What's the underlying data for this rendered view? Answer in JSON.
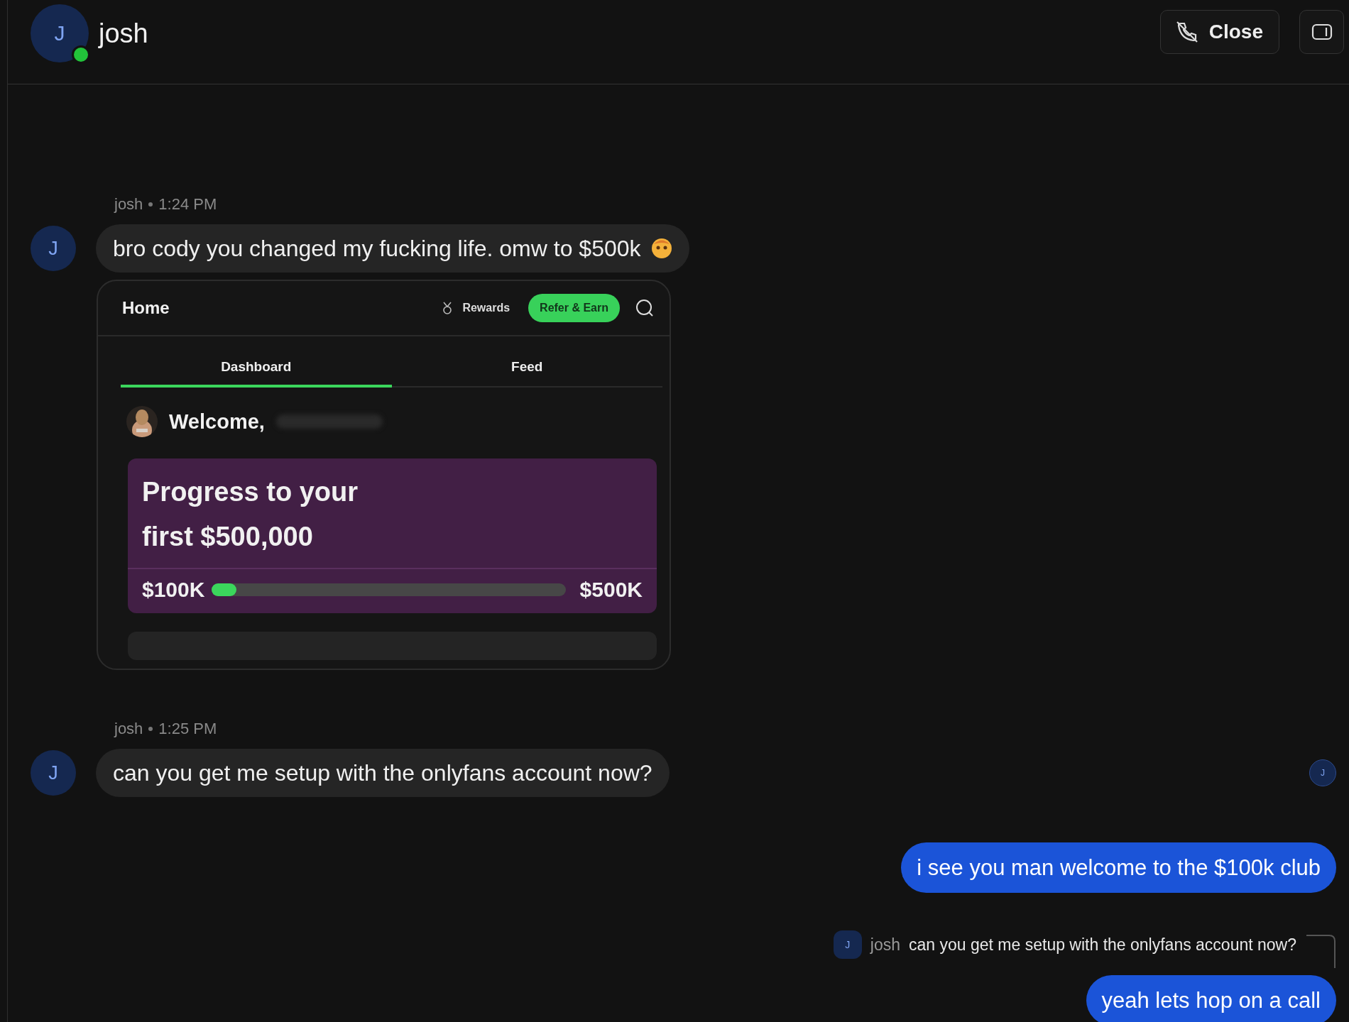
{
  "header": {
    "avatar": "J",
    "name": "josh",
    "online": true,
    "close_button": "Close"
  },
  "messages": [
    {
      "kind": "incoming",
      "sender": "josh",
      "time": "1:24 PM",
      "avatar": "J",
      "text": "bro cody you changed my fucking life. omw to $500k",
      "emoji": true,
      "attachment": {
        "title": "Home",
        "rewards": "Rewards",
        "refer": "Refer & Earn",
        "tabs": [
          {
            "label": "Dashboard",
            "selected": true
          },
          {
            "label": "Feed",
            "selected": false
          }
        ],
        "welcome": "Welcome,",
        "progress_title": "Progress to your first $500,000",
        "start": "$100K",
        "end": "$500K",
        "level": 0.07
      }
    },
    {
      "kind": "incoming",
      "sender": "josh",
      "time": "1:25 PM",
      "avatar": "J",
      "text": "can you get me setup with the onlyfans account now?",
      "seen_by": "J"
    },
    {
      "kind": "outgoing",
      "text": "i see you man welcome to the $100k club"
    },
    {
      "kind": "reply",
      "avatar": "J",
      "sender": "josh",
      "text": "can you get me setup with the onlyfans account now?"
    },
    {
      "kind": "outgoing",
      "text": "yeah lets hop on a call"
    }
  ]
}
